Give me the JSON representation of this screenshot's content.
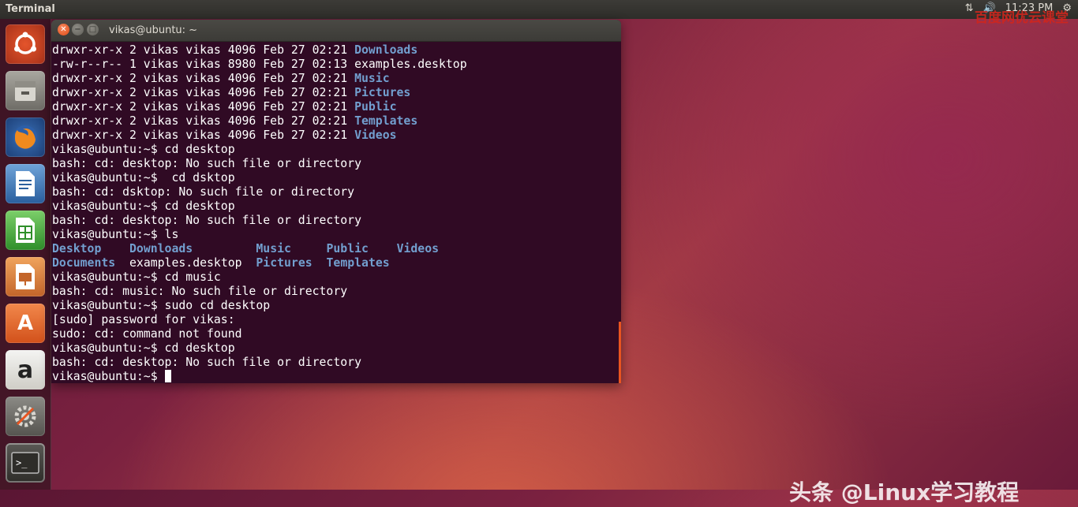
{
  "top_panel": {
    "app_title": "Terminal",
    "network_icon": "network-arrows-icon",
    "volume_icon": "volume-icon",
    "time": "11:23 PM",
    "settings_icon": "gear-icon",
    "watermark": "百度网优云课堂"
  },
  "launcher": [
    {
      "name": "ubuntu-dash-icon"
    },
    {
      "name": "files-icon"
    },
    {
      "name": "firefox-icon"
    },
    {
      "name": "libreoffice-writer-icon"
    },
    {
      "name": "libreoffice-calc-icon"
    },
    {
      "name": "libreoffice-impress-icon"
    },
    {
      "name": "software-center-icon"
    },
    {
      "name": "amazon-icon"
    },
    {
      "name": "system-settings-icon"
    },
    {
      "name": "terminal-icon"
    }
  ],
  "window": {
    "title": "vikas@ubuntu: ~"
  },
  "terminal": {
    "lines": [
      {
        "pre": "drwxr-xr-x 2 vikas vikas 4096 Feb 27 02:21 ",
        "dir": "Downloads",
        "post": ""
      },
      {
        "pre": "-rw-r--r-- 1 vikas vikas 8980 Feb 27 02:13 examples.desktop",
        "dir": "",
        "post": ""
      },
      {
        "pre": "drwxr-xr-x 2 vikas vikas 4096 Feb 27 02:21 ",
        "dir": "Music",
        "post": ""
      },
      {
        "pre": "drwxr-xr-x 2 vikas vikas 4096 Feb 27 02:21 ",
        "dir": "Pictures",
        "post": ""
      },
      {
        "pre": "drwxr-xr-x 2 vikas vikas 4096 Feb 27 02:21 ",
        "dir": "Public",
        "post": ""
      },
      {
        "pre": "drwxr-xr-x 2 vikas vikas 4096 Feb 27 02:21 ",
        "dir": "Templates",
        "post": ""
      },
      {
        "pre": "drwxr-xr-x 2 vikas vikas 4096 Feb 27 02:21 ",
        "dir": "Videos",
        "post": ""
      },
      {
        "pre": "vikas@ubuntu:~$ cd desktop",
        "dir": "",
        "post": ""
      },
      {
        "pre": "bash: cd: desktop: No such file or directory",
        "dir": "",
        "post": ""
      },
      {
        "pre": "vikas@ubuntu:~$  cd dsktop",
        "dir": "",
        "post": ""
      },
      {
        "pre": "bash: cd: dsktop: No such file or directory",
        "dir": "",
        "post": ""
      },
      {
        "pre": "vikas@ubuntu:~$ cd desktop",
        "dir": "",
        "post": ""
      },
      {
        "pre": "bash: cd: desktop: No such file or directory",
        "dir": "",
        "post": ""
      },
      {
        "pre": "vikas@ubuntu:~$ ls",
        "dir": "",
        "post": ""
      }
    ],
    "ls_output": [
      [
        "Desktop",
        "Downloads",
        "Music",
        "Public",
        "Videos"
      ],
      [
        "Documents",
        "examples.desktop",
        "Pictures",
        "Templates"
      ]
    ],
    "lines_after": [
      "vikas@ubuntu:~$ cd music",
      "bash: cd: music: No such file or directory",
      "vikas@ubuntu:~$ sudo cd desktop",
      "[sudo] password for vikas:",
      "sudo: cd: command not found",
      "vikas@ubuntu:~$ cd desktop",
      "bash: cd: desktop: No such file or directory"
    ],
    "prompt": "vikas@ubuntu:~$ "
  },
  "watermark_bottom": "头条 @Linux学习教程"
}
